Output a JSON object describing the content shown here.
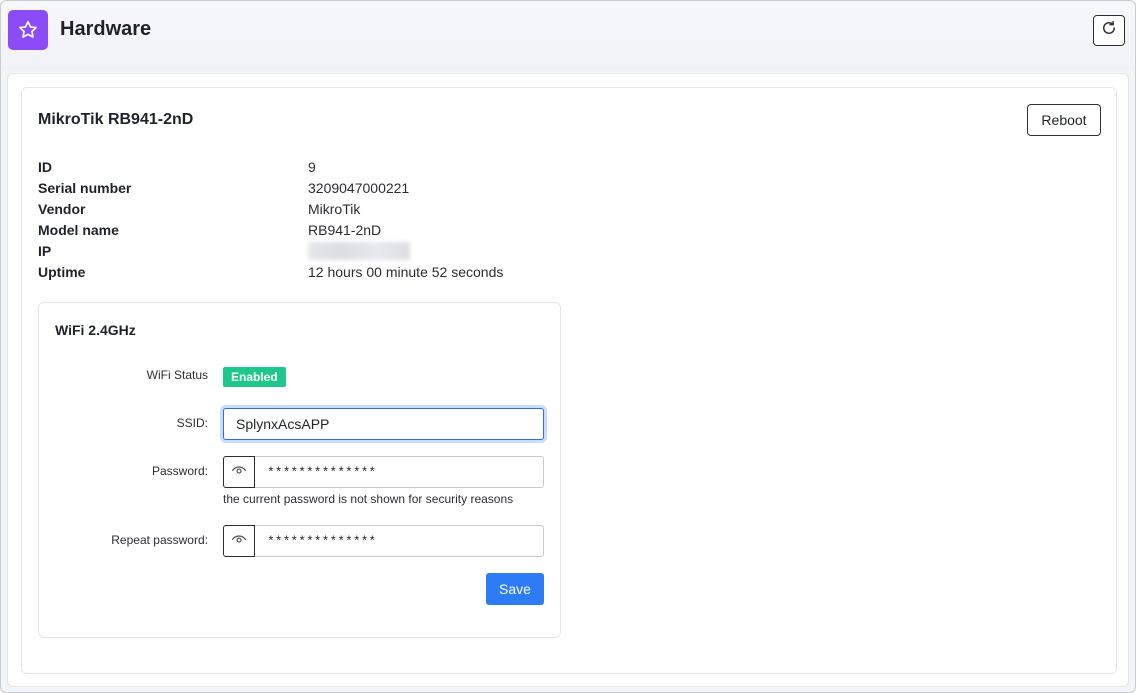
{
  "header": {
    "title": "Hardware",
    "app_icon": "star-icon",
    "refresh_icon": "refresh-icon",
    "accent": "#8b4cf7"
  },
  "device": {
    "title": "MikroTik RB941-2nD",
    "reboot_label": "Reboot",
    "info": [
      {
        "label": "ID",
        "value": "9"
      },
      {
        "label": "Serial number",
        "value": "3209047000221"
      },
      {
        "label": "Vendor",
        "value": "MikroTik"
      },
      {
        "label": "Model name",
        "value": "RB941-2nD"
      },
      {
        "label": "IP",
        "value": ""
      },
      {
        "label": "Uptime",
        "value": "12 hours 00 minute 52 seconds"
      }
    ]
  },
  "wifi": {
    "title": "WiFi 2.4GHz",
    "status_label": "WiFi Status",
    "status_value": "Enabled",
    "status_color": "#1ec88a",
    "ssid_label": "SSID:",
    "ssid_value": "SplynxAcsAPP",
    "password_label": "Password:",
    "password_value": "**************",
    "password_hint": "the current password is not shown for security reasons",
    "repeat_label": "Repeat password:",
    "repeat_value": "**************",
    "save_label": "Save",
    "save_color": "#2d7cf6"
  }
}
